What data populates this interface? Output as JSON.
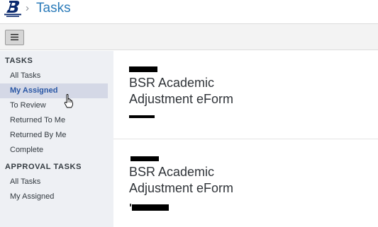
{
  "header": {
    "logo_text": "BOISE STATE UNIVERSITY",
    "breadcrumb_separator": "›",
    "title": "Tasks"
  },
  "toolbar": {
    "menu_icon": "hamburger-icon"
  },
  "sidebar": {
    "sections": [
      {
        "title": "TASKS",
        "items": [
          {
            "label": "All Tasks",
            "active": false
          },
          {
            "label": "My Assigned",
            "active": true
          },
          {
            "label": "To Review",
            "active": false
          },
          {
            "label": "Returned To Me",
            "active": false
          },
          {
            "label": "Returned By Me",
            "active": false
          },
          {
            "label": "Complete",
            "active": false
          }
        ]
      },
      {
        "title": "APPROVAL TASKS",
        "items": [
          {
            "label": "All Tasks",
            "active": false
          },
          {
            "label": "My Assigned",
            "active": false
          }
        ]
      }
    ]
  },
  "tasks": [
    {
      "title_line1": "BSR Academic",
      "title_line2": "Adjustment eForm"
    },
    {
      "title_line1": "BSR Academic",
      "title_line2": "Adjustment eForm"
    }
  ],
  "colors": {
    "accent": "#2b7bb9",
    "active_nav_bg": "#d4d8e6",
    "active_nav_text": "#2a57a5",
    "sidebar_bg": "#eef0f4"
  }
}
